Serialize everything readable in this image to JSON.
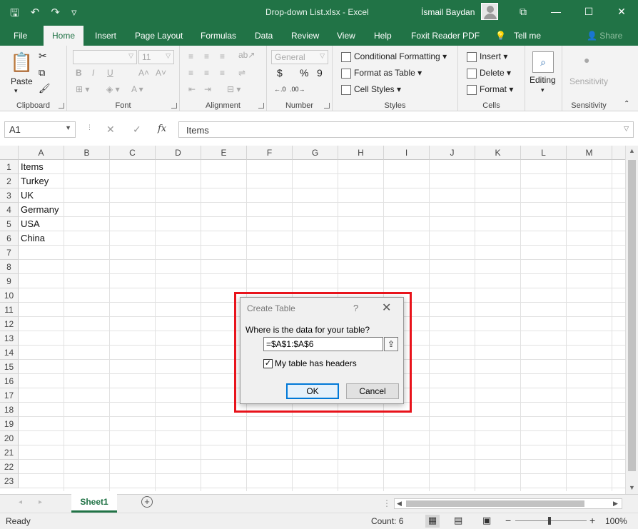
{
  "titlebar": {
    "file_title": "Drop-down List.xlsx  -  Excel",
    "user_name": "İsmail Baydan",
    "qat_icons": [
      "save-icon",
      "undo-icon",
      "redo-icon",
      "customize-icon"
    ],
    "window_buttons": [
      "ribbon-display-icon",
      "minimize-icon",
      "maximize-icon",
      "close-icon"
    ]
  },
  "tabs": [
    "File",
    "Home",
    "Insert",
    "Page Layout",
    "Formulas",
    "Data",
    "Review",
    "View",
    "Help",
    "Foxit Reader PDF",
    "Tell me",
    "Share"
  ],
  "ribbon": {
    "clipboard": {
      "label": "Clipboard",
      "paste": "Paste"
    },
    "font": {
      "label": "Font",
      "size": "11",
      "bold": "B",
      "italic": "I",
      "underline": "U"
    },
    "alignment": {
      "label": "Alignment"
    },
    "number": {
      "label": "Number",
      "format": "General",
      "currency": "$",
      "percent": "%",
      "comma": "9"
    },
    "styles": {
      "label": "Styles",
      "conditional": "Conditional Formatting",
      "format_table": "Format as Table",
      "cell_styles": "Cell Styles"
    },
    "cells": {
      "label": "Cells",
      "insert": "Insert",
      "delete": "Delete",
      "format": "Format"
    },
    "editing": {
      "label": "Editing"
    },
    "sensitivity": {
      "label": "Sensitivity",
      "button": "Sensitivity"
    }
  },
  "formula_bar": {
    "name_box": "A1",
    "cancel": "✕",
    "enter": "✓",
    "fx": "fx",
    "value": "Items"
  },
  "columns": [
    "A",
    "B",
    "C",
    "D",
    "E",
    "F",
    "G",
    "H",
    "I",
    "J",
    "K",
    "L",
    "M"
  ],
  "rows": [
    "1",
    "2",
    "3",
    "4",
    "5",
    "6",
    "7",
    "8",
    "9",
    "10",
    "11",
    "12",
    "13",
    "14",
    "15",
    "16",
    "17",
    "18",
    "19",
    "20",
    "21",
    "22",
    "23"
  ],
  "cells_A": [
    "Items",
    "Turkey",
    "UK",
    "Germany",
    "USA",
    "China"
  ],
  "dialog": {
    "title": "Create Table",
    "help": "?",
    "close": "✕",
    "question": "Where is the data for your table?",
    "range": "=$A$1:$A$6",
    "checkbox_checked": true,
    "checkbox_mark": "✓",
    "checkbox_label": "My table has headers",
    "ok": "OK",
    "cancel": "Cancel"
  },
  "sheets": {
    "active": "Sheet1",
    "add": "+"
  },
  "status": {
    "ready": "Ready",
    "count": "Count: 6",
    "zoom": "100%",
    "zoom_out": "−",
    "zoom_in": "+"
  },
  "colors": {
    "accent": "#217346",
    "highlight": "#e8131b"
  }
}
